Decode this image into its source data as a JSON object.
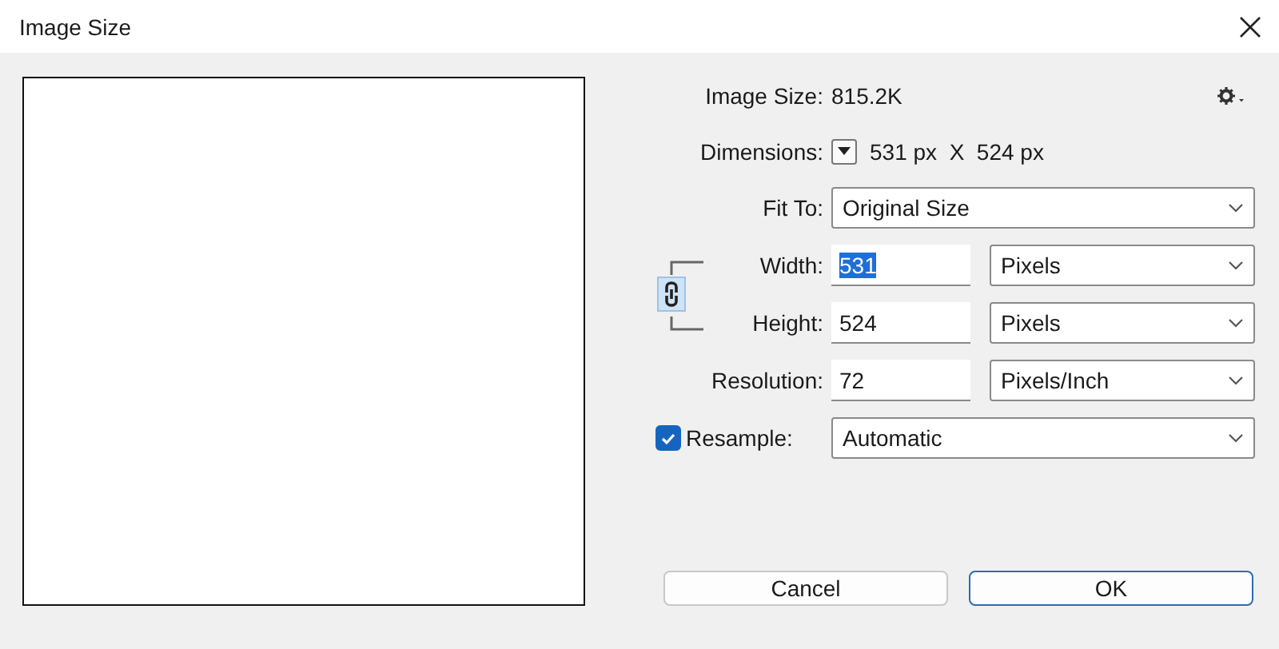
{
  "window": {
    "title": "Image Size"
  },
  "image_size": {
    "label": "Image Size:",
    "value": "815.2K"
  },
  "dimensions": {
    "label": "Dimensions:",
    "value": "531 px  X  524 px"
  },
  "fit_to": {
    "label": "Fit To:",
    "value": "Original Size"
  },
  "constrain_proportions": {
    "linked": true
  },
  "fields": [
    {
      "label": "Width:",
      "value": "531",
      "text_selected": true,
      "unit": "Pixels"
    },
    {
      "label": "Height:",
      "value": "524",
      "text_selected": false,
      "unit": "Pixels"
    },
    {
      "label": "Resolution:",
      "value": "72",
      "text_selected": false,
      "unit": "Pixels/Inch"
    }
  ],
  "resample": {
    "label": "Resample:",
    "checked": true,
    "value": "Automatic"
  },
  "buttons": [
    {
      "label": "Cancel",
      "default": false
    },
    {
      "label": "OK",
      "default": true
    }
  ]
}
